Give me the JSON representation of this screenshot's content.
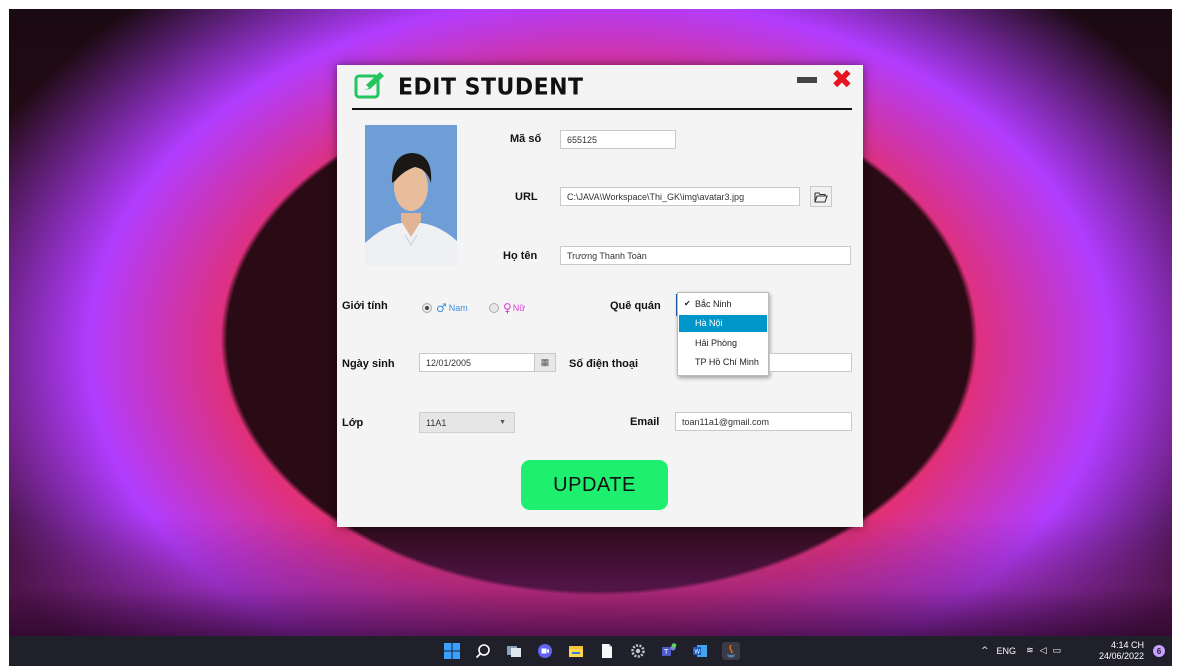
{
  "window": {
    "title": "EDIT STUDENT",
    "close_glyph": "✖"
  },
  "form": {
    "student_id_label": "Mã số",
    "student_id_value": "655125",
    "url_label": "URL",
    "url_value": "C:\\JAVA\\Workspace\\Thi_GK\\img\\avatar3.jpg",
    "fullname_label": "Họ tên",
    "fullname_value": "Trương Thanh Toàn",
    "gender_label": "Giới tính",
    "gender_options": [
      {
        "label": "Nam",
        "symbol": "♂",
        "selected": true,
        "color": "#3b8fe0"
      },
      {
        "label": "Nữ",
        "symbol": "♀",
        "selected": false,
        "color": "#d83ad8"
      }
    ],
    "hometown_label": "Quê quán",
    "hometown_options": [
      "Bắc Ninh",
      "Hà Nội",
      "Hải Phòng",
      "TP Hồ Chí Minh"
    ],
    "hometown_checked": "Bắc Ninh",
    "hometown_highlighted": "Hà Nội",
    "birthdate_label": "Ngày sinh",
    "birthdate_value": "12/01/2005",
    "phone_label": "Số điện thoại",
    "phone_value": "",
    "class_label": "Lớp",
    "class_value": "11A1",
    "email_label": "Email",
    "email_value": "toan11a1@gmail.com",
    "update_label": "UPDATE"
  },
  "taskbar": {
    "language": "ENG",
    "time": "4:14 CH",
    "date": "24/06/2022",
    "notification_count": "6",
    "icons": [
      "windows-start-icon",
      "search-icon",
      "task-view-icon",
      "chat-icon",
      "file-explorer-icon",
      "notepad-icon",
      "settings-icon",
      "teams-icon",
      "word-icon",
      "java-icon"
    ]
  },
  "colors": {
    "accent_green": "#1eef6e",
    "close_red": "#e8141e",
    "dropdown_highlight": "#0096c9"
  }
}
